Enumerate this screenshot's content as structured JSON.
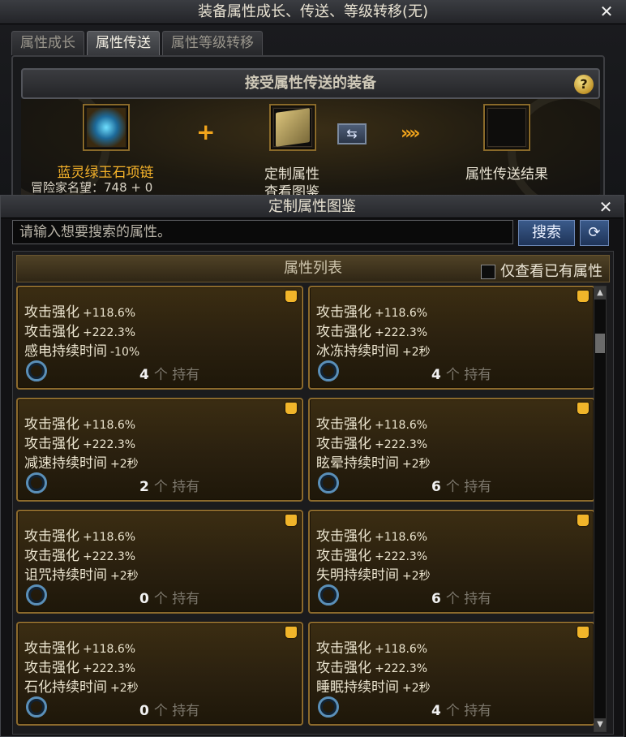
{
  "window": {
    "title": "装备属性成长、传送、等级转移(无)",
    "close": "✕",
    "tabs": [
      "属性成长",
      "属性传送",
      "属性等级转移"
    ],
    "active_tab": 1
  },
  "transfer": {
    "header": "接受属性传送的装备",
    "help": "?",
    "target_item": {
      "name": "蓝灵绿玉石项链",
      "note": "冒险家名望：748 + 0"
    },
    "plus": "+",
    "custom": {
      "label1": "定制属性",
      "label2": "查看图鉴"
    },
    "swap_icon": "⇆",
    "arrows": "»»",
    "result_label": "属性传送结果"
  },
  "popup": {
    "title": "定制属性图鉴",
    "close": "✕",
    "search": {
      "placeholder": "请输入想要搜索的属性。",
      "value": ""
    },
    "search_button": "搜索",
    "refresh_icon": "⟳",
    "list_header": "属性列表",
    "own_only_label": "仅查看已有属性",
    "unit_label": "个 持有",
    "cards": [
      {
        "name": "攻击强化",
        "v1": "+118.6%",
        "name2": "攻击强化",
        "v2": "+222.3%",
        "effect": "感电持续时间",
        "ev": "-10%",
        "count": "4"
      },
      {
        "name": "攻击强化",
        "v1": "+118.6%",
        "name2": "攻击强化",
        "v2": "+222.3%",
        "effect": "冰冻持续时间",
        "ev": "+2秒",
        "count": "4"
      },
      {
        "name": "攻击强化",
        "v1": "+118.6%",
        "name2": "攻击强化",
        "v2": "+222.3%",
        "effect": "减速持续时间",
        "ev": "+2秒",
        "count": "2"
      },
      {
        "name": "攻击强化",
        "v1": "+118.6%",
        "name2": "攻击强化",
        "v2": "+222.3%",
        "effect": "眩晕持续时间",
        "ev": "+2秒",
        "count": "6"
      },
      {
        "name": "攻击强化",
        "v1": "+118.6%",
        "name2": "攻击强化",
        "v2": "+222.3%",
        "effect": "诅咒持续时间",
        "ev": "+2秒",
        "count": "0"
      },
      {
        "name": "攻击强化",
        "v1": "+118.6%",
        "name2": "攻击强化",
        "v2": "+222.3%",
        "effect": "失明持续时间",
        "ev": "+2秒",
        "count": "6"
      },
      {
        "name": "攻击强化",
        "v1": "+118.6%",
        "name2": "攻击强化",
        "v2": "+222.3%",
        "effect": "石化持续时间",
        "ev": "+2秒",
        "count": "0"
      },
      {
        "name": "攻击强化",
        "v1": "+118.6%",
        "name2": "攻击强化",
        "v2": "+222.3%",
        "effect": "睡眠持续时间",
        "ev": "+2秒",
        "count": "4"
      }
    ]
  },
  "colors": {
    "accent_gold": "#f6b32a",
    "card_border": "#8c6a2c",
    "button_blue": "#1f3459"
  },
  "icons": [
    "close-icon",
    "help-icon",
    "necklace-icon",
    "book-icon",
    "swap-icon",
    "arrow-icon",
    "search-icon",
    "refresh-icon",
    "thumb-icon",
    "ring-icon"
  ]
}
